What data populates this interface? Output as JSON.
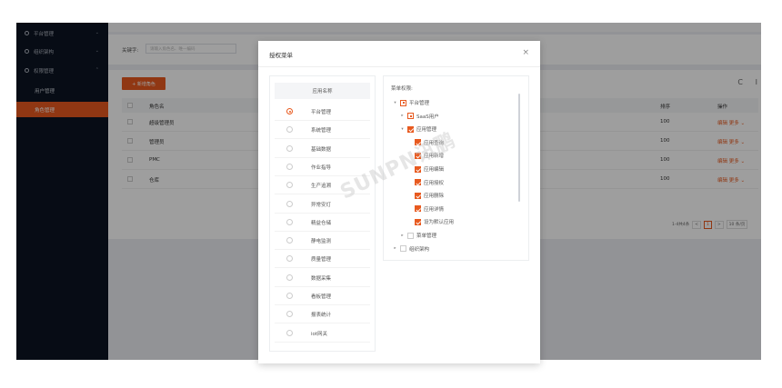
{
  "sidebar": {
    "items": [
      {
        "label": "平台管理",
        "arrow": "⌄"
      },
      {
        "label": "组织架构",
        "arrow": "⌄"
      },
      {
        "label": "权限管理",
        "arrow": "⌃"
      }
    ],
    "sub_items": [
      {
        "label": "用户管理"
      },
      {
        "label": "角色管理"
      }
    ]
  },
  "filter": {
    "keyword_label": "关键字:",
    "keyword_placeholder": "请输入角色名、唯一编码"
  },
  "toolbar": {
    "add_label": "+ 新增角色",
    "refresh_icon": "C",
    "columns_icon": "I"
  },
  "table": {
    "headers": {
      "name": "角色名",
      "op_col": "排序",
      "action_col": "操作"
    },
    "rows": [
      {
        "name": "超级管理员",
        "op": "100",
        "action": "编辑  更多 ⌄"
      },
      {
        "name": "管理员",
        "op": "100",
        "action": "编辑  更多 ⌄"
      },
      {
        "name": "PMC",
        "op": "100",
        "action": "编辑  更多 ⌄"
      },
      {
        "name": "仓库",
        "op": "100",
        "action": "编辑  更多 ⌄"
      }
    ],
    "pagination": {
      "total": "1-4共4条",
      "prev": "<",
      "current": "1",
      "next": ">",
      "page_size": "10 条/页"
    }
  },
  "dialog": {
    "title": "授权菜单",
    "close": "×",
    "app_header": "应用名称",
    "apps": [
      "平台管理",
      "系统管理",
      "基础数据",
      "作业指导",
      "生产追溯",
      "异常安灯",
      "精益仓储",
      "静电监测",
      "质量管理",
      "数据采集",
      "看板管理",
      "报表统计",
      "iot网关"
    ],
    "selected_app_index": 0,
    "perm_title": "菜单权限:",
    "tree": [
      {
        "label": "平台管理",
        "level": 0,
        "toggle": "▾",
        "state": "half"
      },
      {
        "label": "SaaS用户",
        "level": 1,
        "toggle": "▸",
        "state": "half"
      },
      {
        "label": "应用管理",
        "level": 1,
        "toggle": "▾",
        "state": "on"
      },
      {
        "label": "应用查询",
        "level": 2,
        "toggle": "",
        "state": "on"
      },
      {
        "label": "应用新增",
        "level": 2,
        "toggle": "",
        "state": "on"
      },
      {
        "label": "应用编辑",
        "level": 2,
        "toggle": "",
        "state": "on"
      },
      {
        "label": "应用授权",
        "level": 2,
        "toggle": "",
        "state": "on"
      },
      {
        "label": "应用删除",
        "level": 2,
        "toggle": "",
        "state": "on"
      },
      {
        "label": "应用详情",
        "level": 2,
        "toggle": "",
        "state": "on"
      },
      {
        "label": "设为默认应用",
        "level": 2,
        "toggle": "",
        "state": "on"
      },
      {
        "label": "菜单管理",
        "level": 1,
        "toggle": "▸",
        "state": "off"
      },
      {
        "label": "组织架构",
        "level": 0,
        "toggle": "▸",
        "state": "off"
      }
    ]
  },
  "watermark": "SUNPN讯鹏",
  "colors": {
    "accent": "#e85a1f",
    "sidebar": "#0c1422"
  }
}
